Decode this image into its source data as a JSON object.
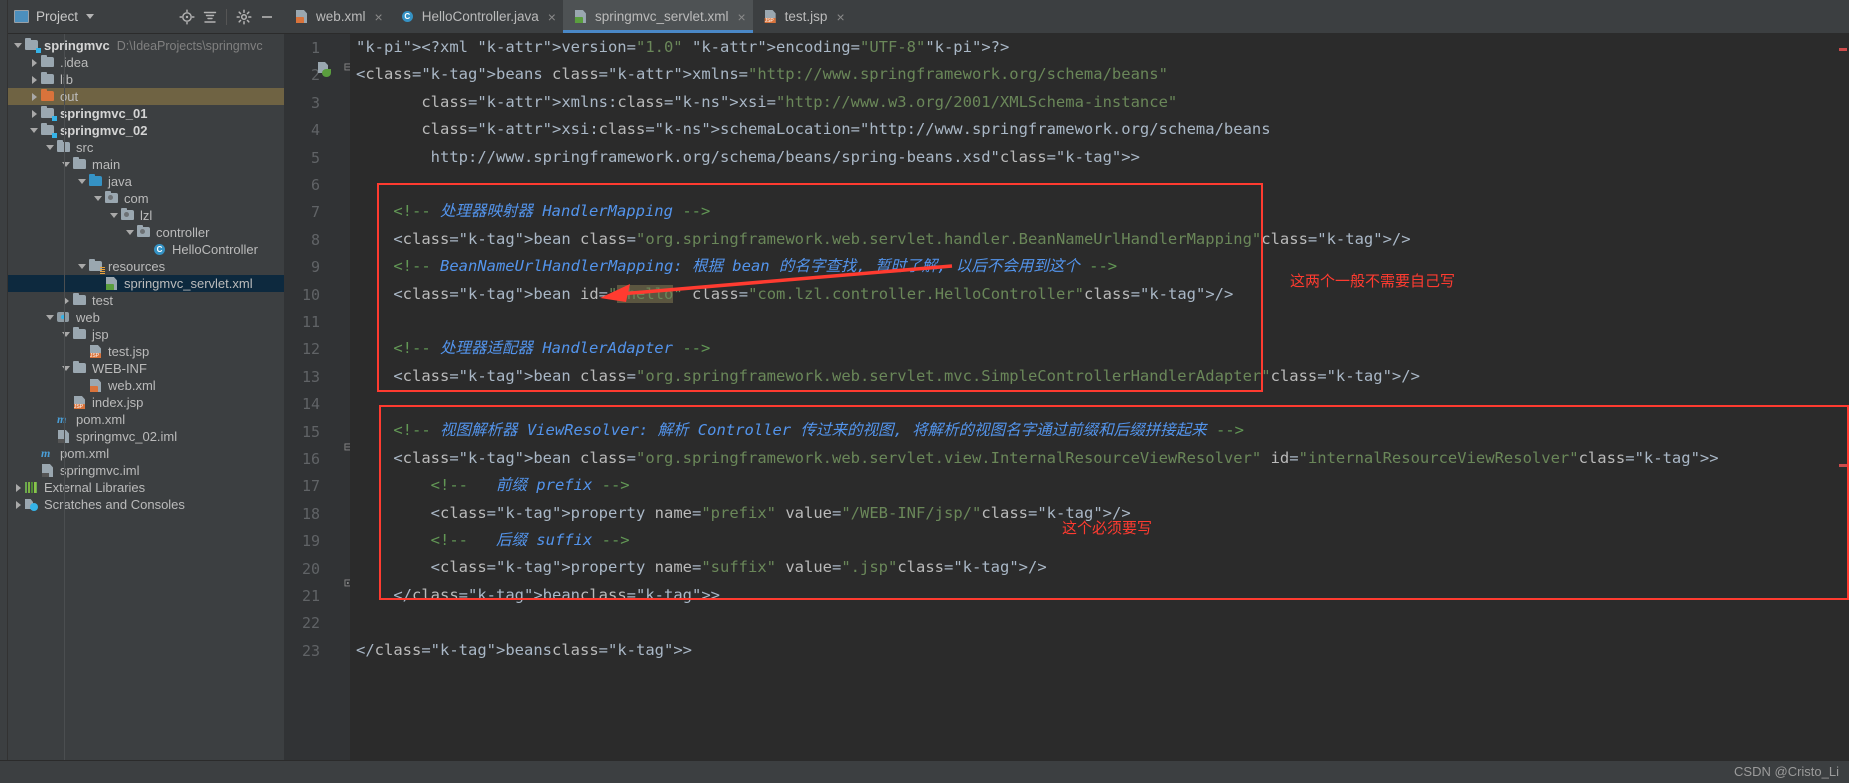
{
  "window": {
    "project_panel_title": "Project"
  },
  "toolbar": {
    "locate_icon": "crosshair-icon",
    "collapse_icon": "collapse-all-icon",
    "settings_icon": "gear-icon",
    "hide_icon": "minimize-icon"
  },
  "tree": [
    {
      "indent": 0,
      "twisty": "down",
      "icon": "module-folder",
      "label": "springmvc",
      "bold": true,
      "path": "D:\\IdeaProjects\\springmvc",
      "selected": "none"
    },
    {
      "indent": 1,
      "twisty": "right",
      "icon": "folder-gray",
      "label": ".idea",
      "bold": false,
      "path": "",
      "selected": "none"
    },
    {
      "indent": 1,
      "twisty": "right",
      "icon": "folder-gray",
      "label": "lib",
      "bold": false,
      "path": "",
      "selected": "none"
    },
    {
      "indent": 1,
      "twisty": "right",
      "icon": "folder-orange",
      "label": "out",
      "bold": false,
      "path": "",
      "selected": "out"
    },
    {
      "indent": 1,
      "twisty": "right",
      "icon": "module-folder",
      "label": "springmvc_01",
      "bold": true,
      "path": "",
      "selected": "none"
    },
    {
      "indent": 1,
      "twisty": "down",
      "icon": "module-folder",
      "label": "springmvc_02",
      "bold": true,
      "path": "",
      "selected": "none"
    },
    {
      "indent": 2,
      "twisty": "down",
      "icon": "folder-gray",
      "label": "src",
      "bold": false,
      "path": "",
      "selected": "none"
    },
    {
      "indent": 3,
      "twisty": "down",
      "icon": "folder-gray",
      "label": "main",
      "bold": false,
      "path": "",
      "selected": "none"
    },
    {
      "indent": 4,
      "twisty": "down",
      "icon": "folder-blue",
      "label": "java",
      "bold": false,
      "path": "",
      "selected": "none"
    },
    {
      "indent": 5,
      "twisty": "down",
      "icon": "package",
      "label": "com",
      "bold": false,
      "path": "",
      "selected": "none"
    },
    {
      "indent": 6,
      "twisty": "down",
      "icon": "package",
      "label": "lzl",
      "bold": false,
      "path": "",
      "selected": "none"
    },
    {
      "indent": 7,
      "twisty": "down",
      "icon": "package",
      "label": "controller",
      "bold": false,
      "path": "",
      "selected": "none"
    },
    {
      "indent": 8,
      "twisty": "none",
      "icon": "java-class",
      "label": "HelloController",
      "bold": false,
      "path": "",
      "selected": "none"
    },
    {
      "indent": 4,
      "twisty": "down",
      "icon": "folder-res",
      "label": "resources",
      "bold": false,
      "path": "",
      "selected": "none"
    },
    {
      "indent": 5,
      "twisty": "none",
      "icon": "xml-spring",
      "label": "springmvc_servlet.xml",
      "bold": false,
      "path": "",
      "selected": "blue"
    },
    {
      "indent": 3,
      "twisty": "right",
      "icon": "folder-gray",
      "label": "test",
      "bold": false,
      "path": "",
      "selected": "none"
    },
    {
      "indent": 2,
      "twisty": "down",
      "icon": "web-module",
      "label": "web",
      "bold": false,
      "path": "",
      "selected": "none"
    },
    {
      "indent": 3,
      "twisty": "down",
      "icon": "folder-gray",
      "label": "jsp",
      "bold": false,
      "path": "",
      "selected": "none"
    },
    {
      "indent": 4,
      "twisty": "none",
      "icon": "jsp-file",
      "label": "test.jsp",
      "bold": false,
      "path": "",
      "selected": "none"
    },
    {
      "indent": 3,
      "twisty": "down",
      "icon": "folder-gray",
      "label": "WEB-INF",
      "bold": false,
      "path": "",
      "selected": "none"
    },
    {
      "indent": 4,
      "twisty": "none",
      "icon": "xml-web",
      "label": "web.xml",
      "bold": false,
      "path": "",
      "selected": "none"
    },
    {
      "indent": 3,
      "twisty": "none",
      "icon": "jsp-file",
      "label": "index.jsp",
      "bold": false,
      "path": "",
      "selected": "none"
    },
    {
      "indent": 2,
      "twisty": "none",
      "icon": "maven-file",
      "label": "pom.xml",
      "bold": false,
      "path": "",
      "selected": "none"
    },
    {
      "indent": 2,
      "twisty": "none",
      "icon": "iml-file",
      "label": "springmvc_02.iml",
      "bold": false,
      "path": "",
      "selected": "none"
    },
    {
      "indent": 1,
      "twisty": "none",
      "icon": "maven-file",
      "label": "pom.xml",
      "bold": false,
      "path": "",
      "selected": "none"
    },
    {
      "indent": 1,
      "twisty": "none",
      "icon": "iml-file",
      "label": "springmvc.iml",
      "bold": false,
      "path": "",
      "selected": "none"
    },
    {
      "indent": 0,
      "twisty": "right",
      "icon": "libraries",
      "label": "External Libraries",
      "bold": false,
      "path": "",
      "selected": "none"
    },
    {
      "indent": 0,
      "twisty": "right",
      "icon": "scratches",
      "label": "Scratches and Consoles",
      "bold": false,
      "path": "",
      "selected": "none"
    }
  ],
  "tabs": [
    {
      "label": "web.xml",
      "icon": "xml-web",
      "active": false,
      "close": "×"
    },
    {
      "label": "HelloController.java",
      "icon": "java-class",
      "active": false,
      "close": "×"
    },
    {
      "label": "springmvc_servlet.xml",
      "icon": "xml-spring",
      "active": true,
      "close": "×"
    },
    {
      "label": "test.jsp",
      "icon": "jsp-file",
      "active": false,
      "close": "×"
    }
  ],
  "editor": {
    "line_numbers": [
      "1",
      "2",
      "3",
      "4",
      "5",
      "6",
      "7",
      "8",
      "9",
      "10",
      "11",
      "12",
      "13",
      "14",
      "15",
      "16",
      "17",
      "18",
      "19",
      "20",
      "21",
      "22",
      "23"
    ],
    "lines": [
      "<?xml version=\"1.0\" encoding=\"UTF-8\"?>",
      "<beans xmlns=\"http://www.springframework.org/schema/beans\"",
      "       xmlns:xsi=\"http://www.w3.org/2001/XMLSchema-instance\"",
      "       xsi:schemaLocation=\"http://www.springframework.org/schema/beans",
      "        http://www.springframework.org/schema/beans/spring-beans.xsd\">",
      "",
      "    <!-- 处理器映射器 HandlerMapping -->",
      "    <bean class=\"org.springframework.web.servlet.handler.BeanNameUrlHandlerMapping\"/>",
      "    <!-- BeanNameUrlHandlerMapping: 根据 bean 的名字查找, 暂时了解, 以后不会用到这个 -->",
      "    <bean id=\"/hello\" class=\"com.lzl.controller.HelloController\"/>",
      "",
      "    <!-- 处理器适配器 HandlerAdapter -->",
      "    <bean class=\"org.springframework.web.servlet.mvc.SimpleControllerHandlerAdapter\"/>",
      "",
      "    <!-- 视图解析器 ViewResolver: 解析 Controller 传过来的视图, 将解析的视图名字通过前缀和后缀拼接起来 -->",
      "    <bean class=\"org.springframework.web.servlet.view.InternalResourceViewResolver\" id=\"internalResourceViewResolver\">",
      "        <!--   前缀 prefix -->",
      "        <property name=\"prefix\" value=\"/WEB-INF/jsp/\"/>",
      "        <!--   后缀 suffix -->",
      "        <property name=\"suffix\" value=\".jsp\"/>",
      "    </bean>",
      "",
      "</beans>"
    ],
    "highlighted_token": "/hello"
  },
  "annotations": [
    {
      "name": "note-right-top",
      "text": "这两个一般不需要自己写"
    },
    {
      "name": "note-right-mid",
      "text": "这个必须要写"
    }
  ],
  "colors": {
    "accent_red": "#ff3b30",
    "tab_active_underline": "#4a88c7",
    "editor_bg": "#2b2b2b",
    "panel_bg": "#3c3f41",
    "selection_blue": "#0d293e",
    "selection_olive": "#6f6343",
    "string_green": "#6a8759",
    "tag_yellow": "#e8bf6a",
    "comment_green": "#629755",
    "comment_blue": "#5394ec"
  },
  "watermark": {
    "text": "CSDN @Cristo_Li"
  }
}
